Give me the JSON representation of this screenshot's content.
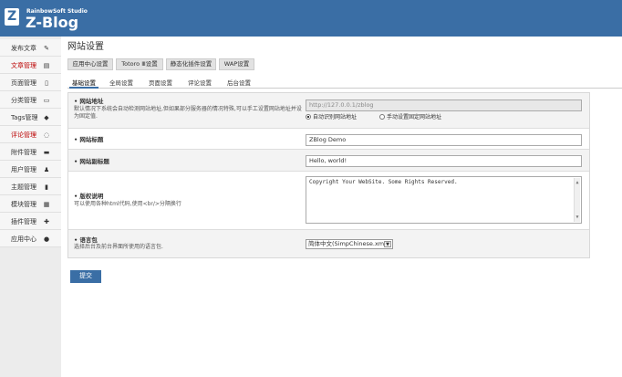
{
  "header": {
    "studio": "RainbowSoft Studio",
    "brand": "Z-Blog",
    "logo_letter": "Z"
  },
  "sidebar": {
    "items": [
      {
        "label": "发布文章",
        "icon": "edit-icon",
        "glyph": "✎"
      },
      {
        "label": "文章管理",
        "icon": "document-icon",
        "glyph": "▤"
      },
      {
        "label": "页面管理",
        "icon": "page-icon",
        "glyph": "▯"
      },
      {
        "label": "分类管理",
        "icon": "folder-icon",
        "glyph": "▭"
      },
      {
        "label": "Tags管理",
        "icon": "tag-icon",
        "glyph": "◆"
      },
      {
        "label": "评论管理",
        "icon": "comment-icon",
        "glyph": "◌"
      },
      {
        "label": "附件管理",
        "icon": "attachment-icon",
        "glyph": "▬"
      },
      {
        "label": "用户管理",
        "icon": "user-icon",
        "glyph": "♟"
      },
      {
        "label": "主题管理",
        "icon": "theme-icon",
        "glyph": "▮"
      },
      {
        "label": "模块管理",
        "icon": "module-icon",
        "glyph": "▦"
      },
      {
        "label": "插件管理",
        "icon": "plugin-icon",
        "glyph": "✚"
      },
      {
        "label": "应用中心",
        "icon": "app-center-icon",
        "glyph": "●"
      }
    ]
  },
  "main": {
    "title": "网站设置",
    "subtabs": [
      "应用中心设置",
      "Totoro Ⅲ设置",
      "静态化插件设置",
      "WAP设置"
    ],
    "tabs": [
      "基础设置",
      "全局设置",
      "页面设置",
      "评论设置",
      "后台设置"
    ],
    "rows": {
      "host": {
        "title": "网站地址",
        "desc": "默认情况下系统会自动检测网站地址,但如果部分服务器的情况特殊,可以手工设置网站地址并设为固定值.",
        "value": "http://127.0.0.1/zblog",
        "radio_auto": "自动识别网站地址",
        "radio_fixed": "手动设置固定网站地址"
      },
      "name": {
        "title": "网站标题",
        "value": "ZBlog Demo"
      },
      "subname": {
        "title": "网站副标题",
        "value": "Hello, world!"
      },
      "copyright": {
        "title": "版权说明",
        "desc": "可以使用各种html代码,使用<br/>分隔换行",
        "value": "Copyright Your WebSite. Some Rights Reserved."
      },
      "language": {
        "title": "语言包",
        "desc": "选择后台及前台界面所使用的语言包.",
        "value": "简体中文(SimpChinese.xml)"
      }
    },
    "submit_label": "提交"
  }
}
